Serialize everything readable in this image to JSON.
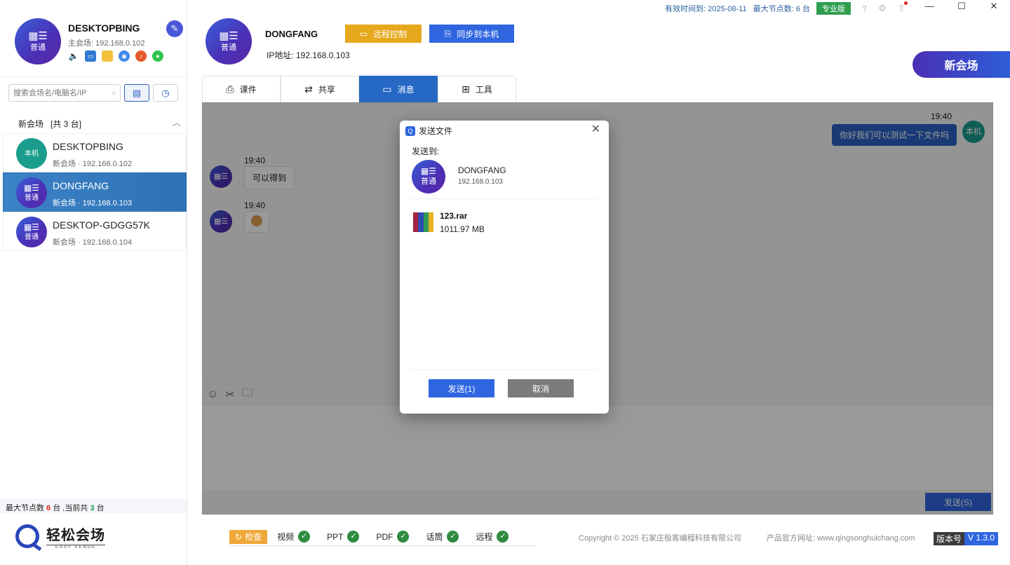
{
  "top_bar": {
    "validity": "有效时间到: 2025-08-11",
    "max_nodes": "最大节点数: 6 台",
    "edition": "专业版"
  },
  "left": {
    "self": {
      "name": "DESKTOPBING",
      "main_venue": "主会场: 192.168.0.102",
      "avatar_label": "普通"
    },
    "search": {
      "placeholder": "搜索会场名/电脑名/IP"
    },
    "group": {
      "title": "新会场   [共 3 台]"
    },
    "devices": [
      {
        "name": "DESKTOPBING",
        "ip": "新会场 · 192.168.0.102",
        "avatar_label": "本机"
      },
      {
        "name": "DONGFANG",
        "ip": "新会场 · 192.168.0.103",
        "avatar_label": "普通"
      },
      {
        "name": "DESKTOP-GDGG57K",
        "ip": "新会场 · 192.168.0.104",
        "avatar_label": "普通"
      }
    ],
    "node_info": {
      "prefix": "最大节点数",
      "max": "6",
      "mid": "台 ,当前共",
      "current": "3",
      "suffix": "台"
    },
    "logo": {
      "title": "轻松会场",
      "subtitle": "EASY VENUE"
    }
  },
  "peer": {
    "name": "DONGFANG",
    "ip": "IP地址: 192.168.0.103",
    "avatar_label": "普通",
    "remote_label": "远程控制",
    "sync_label": "同步到本机"
  },
  "new_session_label": "新会场",
  "tabs": [
    {
      "label": "课件",
      "icon": "courseware-icon"
    },
    {
      "label": "共享",
      "icon": "share-folder-icon"
    },
    {
      "label": "消息",
      "icon": "message-icon"
    },
    {
      "label": "工具",
      "icon": "tools-grid-icon"
    }
  ],
  "chat": {
    "messages": [
      {
        "time": "19:40",
        "text": "你好我们可以测试一下文件吗",
        "side": "out"
      },
      {
        "time": "19:40",
        "text": "可以得到",
        "side": "in"
      },
      {
        "time": "19:40",
        "text": "",
        "side": "in",
        "emoji": true
      }
    ],
    "self_avatar_label": "本机",
    "send_label": "发送(S)"
  },
  "dialog": {
    "title": "发送文件",
    "to_label": "发送到:",
    "peer_name": "DONGFANG",
    "peer_ip": "192.168.0.103",
    "avatar_label": "普通",
    "file": {
      "name": "123.rar",
      "size": "1011.97 MB"
    },
    "send_label": "发送(1)",
    "cancel_label": "取消"
  },
  "footer": {
    "check_label": "检查",
    "checks": [
      "视频",
      "PPT",
      "PDF",
      "话筒",
      "远程"
    ],
    "copyright": "Copyright © 2025 石家庄极客编程科技有限公司",
    "website": "产品官方网址: www.qingsonghuichang.com",
    "version_key": "版本号",
    "version_value": "V 1.3.0"
  }
}
